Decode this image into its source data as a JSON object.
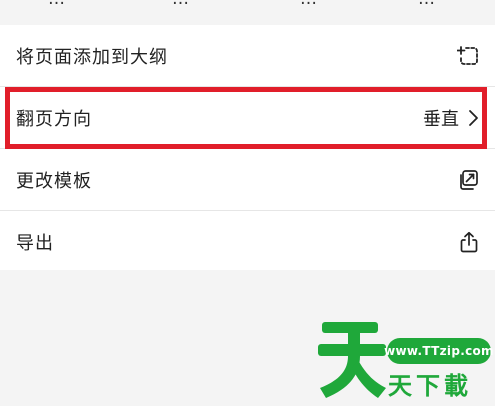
{
  "top_tabs": [
    "...",
    "...",
    "...",
    "..."
  ],
  "menu": {
    "items": [
      {
        "label": "将页面添加到大纲",
        "icon": "add-to-outline-icon"
      },
      {
        "label": "翻页方向",
        "value": "垂直",
        "icon": "chevron-right-icon"
      },
      {
        "label": "更改模板",
        "icon": "change-template-icon"
      },
      {
        "label": "导出",
        "icon": "share-export-icon"
      }
    ]
  },
  "watermark": {
    "url": "www.TTzip.com",
    "text": "天下載",
    "big_char": "天",
    "color": "#1fa83a"
  },
  "highlight_color": "#e11e2a"
}
